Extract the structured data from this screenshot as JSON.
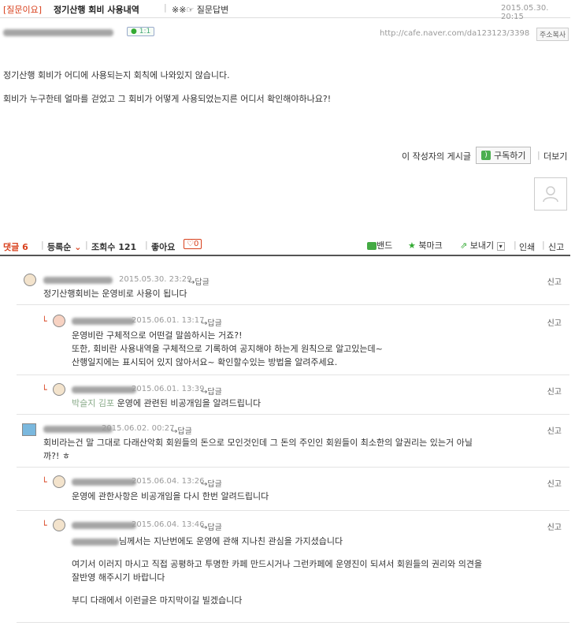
{
  "header": {
    "category": "[질문이요]",
    "title": "정기산행 회비 사용내역",
    "board": "※※☞ 질문답변",
    "date": "2015.05.30. 20:15"
  },
  "author_row": {
    "chat_count": "1:1",
    "url": "http://cafe.naver.com/da123123/3398",
    "copy_label": "주소복사"
  },
  "post": {
    "line1": "정기산행 회비가 어디에 사용되는지 회칙에 나와있지 않습니다.",
    "line2": "회비가 누구한테 얼마를 걷었고 그 회비가 어떻게 사용되었는지른 어디서 확인해야하나요?!"
  },
  "author_links": {
    "posts_label": "이 작성자의 게시글",
    "subscribe_label": "구독하기",
    "more_label": "더보기"
  },
  "comment_bar": {
    "comment_label": "댓글",
    "comment_count": "6",
    "sort_label": "등록순",
    "views_label": "조회수",
    "views_count": "121",
    "like_label": "좋아요",
    "like_count": "0",
    "band_label": "밴드",
    "bookmark_label": "북마크",
    "send_label": "보내기",
    "print_label": "인쇄",
    "report_label": "신고"
  },
  "comments": [
    {
      "date": "2015.05.30. 23:29",
      "reply": "답글",
      "report": "신고",
      "lines": [
        "정기산행회비는 운영비로 사용이 됩니다"
      ]
    },
    {
      "date": "2015.06.01. 13:17",
      "reply": "답글",
      "report": "신고",
      "lines": [
        "운영비란 구체적으로 어떤걸 말씀하시는 거죠?!",
        "또한, 회비란 사용내역을 구체적으로 기록하여 공지해야 하는게 원칙으로 알고있는데~",
        "산행일지에는 표시되어 있지 않아서요~ 확인할수있는 방법을 알려주세요."
      ]
    },
    {
      "date": "2015.06.01. 13:39",
      "reply": "답글",
      "report": "신고",
      "tag": "박슬지 김포",
      "lines": [
        "운영에 관련된 비공개임을 알려드립니다"
      ]
    },
    {
      "date": "2015.06.02. 00:27",
      "reply": "답글",
      "report": "신고",
      "lines": [
        "회비라는건 말 그대로 다래산악회 회원들의 돈으로 모인것인데 그 돈의 주인인 회원들이 최소한의 알권리는 있는거 아닐",
        "까?! ㅎ"
      ]
    },
    {
      "date": "2015.06.04. 13:26",
      "reply": "답글",
      "report": "신고",
      "lines": [
        "운영에 관한사항은 비공개임을 다시 한번 알려드립니다"
      ]
    },
    {
      "date": "2015.06.04. 13:46",
      "reply": "답글",
      "report": "신고",
      "lines": [
        "님께서는 지난번에도 운영에 관해 지나친 관심을 가지셨습니다",
        "여기서 이러지 마시고 직접 공평하고 투명한 카페 만드시거나 그런카페에 운영진이 되셔서 회원들의 권리와 의견을",
        "잘반영 해주시기 바랍니다",
        "부디 다래에서 이런글은 마지막이길 빌겠습니다"
      ]
    }
  ]
}
